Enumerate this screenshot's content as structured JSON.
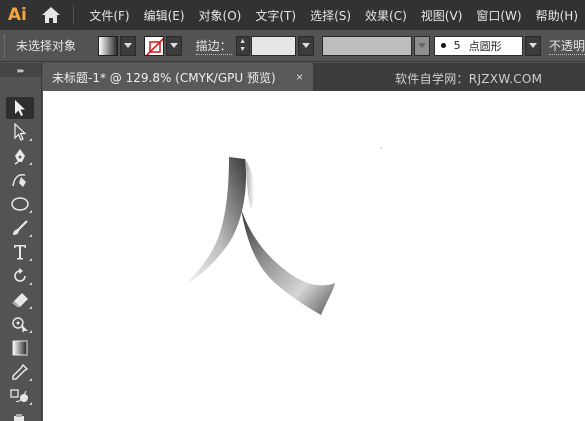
{
  "app": {
    "logo_text": "Ai"
  },
  "menu": {
    "items": [
      {
        "label": "文件(F)"
      },
      {
        "label": "编辑(E)"
      },
      {
        "label": "对象(O)"
      },
      {
        "label": "文字(T)"
      },
      {
        "label": "选择(S)"
      },
      {
        "label": "效果(C)"
      },
      {
        "label": "视图(V)"
      },
      {
        "label": "窗口(W)"
      },
      {
        "label": "帮助(H)"
      }
    ]
  },
  "control_bar": {
    "selection_status": "未选择对象",
    "stroke_label": "描边：",
    "stroke_weight_value": "",
    "brush_size": "5",
    "brush_name": "点圆形",
    "opacity_label": "不透明"
  },
  "document": {
    "tab_title": "未标题-1* @ 129.8% (CMYK/GPU 预览)",
    "close_glyph": "×",
    "watermark": "软件自学网：RJZXW.COM"
  },
  "canvas_art": {
    "character": "人",
    "fill": "gray gradient ribbon"
  },
  "colors": {
    "menubar_bg": "#323232",
    "panel_bg": "#535353",
    "canvas_bg": "#ffffff",
    "logo": "#f7a63b"
  },
  "toolbar": {
    "tools": [
      {
        "name": "selection-tool-icon"
      },
      {
        "name": "direct-selection-tool-icon"
      },
      {
        "name": "pen-tool-icon"
      },
      {
        "name": "curvature-tool-icon"
      },
      {
        "name": "ellipse-tool-icon"
      },
      {
        "name": "paintbrush-tool-icon"
      },
      {
        "name": "type-tool-icon"
      },
      {
        "name": "rotate-tool-icon"
      },
      {
        "name": "eraser-tool-icon"
      },
      {
        "name": "puppet-warp-tool-icon"
      },
      {
        "name": "gradient-tool-icon"
      },
      {
        "name": "eyedropper-tool-icon"
      },
      {
        "name": "blend-tool-icon"
      },
      {
        "name": "symbol-sprayer-tool-icon"
      }
    ]
  }
}
